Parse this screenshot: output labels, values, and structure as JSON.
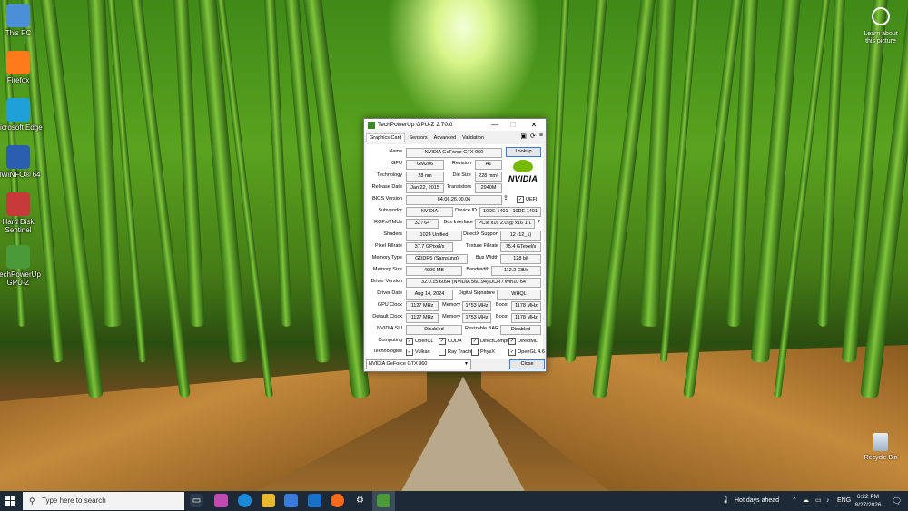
{
  "desktop": {
    "icons": [
      {
        "label": "This PC",
        "color": "#4a8fd8"
      },
      {
        "label": "Firefox",
        "color": "#ff7a1a"
      },
      {
        "label": "Microsoft Edge",
        "color": "#1fa0d8"
      },
      {
        "label": "HWiNFO® 64",
        "color": "#2a5fb0"
      },
      {
        "label": "Hard Disk Sentinel",
        "color": "#c83a3a"
      },
      {
        "label": "TechPowerUp GPU-Z",
        "color": "#4a9a3a"
      }
    ],
    "learn_label": "Learn about this picture",
    "recycle_label": "Recycle Bin"
  },
  "window": {
    "title": "TechPowerUp GPU-Z 2.70.0",
    "minimize": "—",
    "maximize": "☐",
    "close": "✕",
    "tabs": [
      "Graphics Card",
      "Sensors",
      "Advanced",
      "Validation"
    ],
    "lookup": "Lookup",
    "nvidia_logo_text": "NVIDIA",
    "fields": {
      "name_label": "Name",
      "name": "NVIDIA GeForce GTX 960",
      "gpu_label": "GPU",
      "gpu": "GM206",
      "revision_label": "Revision",
      "revision": "A1",
      "technology_label": "Technology",
      "technology": "28 nm",
      "die_size_label": "Die Size",
      "die_size": "228 mm²",
      "release_date_label": "Release Date",
      "release_date": "Jan 22, 2015",
      "transistors_label": "Transistors",
      "transistors": "2940M",
      "bios_label": "BIOS Version",
      "bios": "84.06.26.00.06",
      "uefi_label": "UEFI",
      "subvendor_label": "Subvendor",
      "subvendor": "NVIDIA",
      "device_id_label": "Device ID",
      "device_id": "10DE 1401 - 10DE 1401",
      "rops_label": "ROPs/TMUs",
      "rops": "32 / 64",
      "bus_interface_label": "Bus Interface",
      "bus_interface": "PCIe x16 2.0 @ x16 1.1",
      "help": "?",
      "shaders_label": "Shaders",
      "shaders": "1024 Unified",
      "directx_label": "DirectX Support",
      "directx": "12 (12_1)",
      "pixel_fillrate_label": "Pixel Fillrate",
      "pixel_fillrate": "37.7 GPixel/s",
      "texture_fillrate_label": "Texture Fillrate",
      "texture_fillrate": "75.4 GTexel/s",
      "memory_type_label": "Memory Type",
      "memory_type": "GDDR5 (Samsung)",
      "bus_width_label": "Bus Width",
      "bus_width": "128 bit",
      "memory_size_label": "Memory Size",
      "memory_size": "4096 MB",
      "bandwidth_label": "Bandwidth",
      "bandwidth": "112.2 GB/s",
      "driver_version_label": "Driver Version",
      "driver_version": "32.0.15.6094 (NVIDIA 560.94) DCH / Win10 64",
      "driver_date_label": "Driver Date",
      "driver_date": "Aug 14, 2024",
      "digital_signature_label": "Digital Signature",
      "digital_signature": "WHQL",
      "gpu_clock_label": "GPU Clock",
      "gpu_clock": "1127 MHz",
      "memory_clock_label": "Memory",
      "memory_clock": "1753 MHz",
      "boost_label": "Boost",
      "boost": "1178 MHz",
      "default_clock_label": "Default Clock",
      "default_clock": "1127 MHz",
      "default_memory": "1753 MHz",
      "default_boost": "1178 MHz",
      "sli_label": "NVIDIA SLI",
      "sli": "Disabled",
      "resizable_bar_label": "Resizable BAR",
      "resizable_bar": "Disabled"
    },
    "computing_label": "Computing",
    "computing": [
      {
        "label": "OpenCL",
        "checked": true
      },
      {
        "label": "CUDA",
        "checked": true
      },
      {
        "label": "DirectCompute",
        "checked": true
      },
      {
        "label": "DirectML",
        "checked": true
      }
    ],
    "technologies_label": "Technologies",
    "technologies": [
      {
        "label": "Vulkan",
        "checked": true
      },
      {
        "label": "Ray Tracing",
        "checked": false
      },
      {
        "label": "PhysX",
        "checked": false
      },
      {
        "label": "OpenGL 4.6",
        "checked": true
      }
    ],
    "gpu_select": "NVIDIA GeForce GTX 960",
    "close_button": "Close"
  },
  "taskbar": {
    "search_placeholder": "Type here to search",
    "weather": "Hot days ahead",
    "language": "ENG",
    "time": "6:22 PM",
    "date": "8/27/2026"
  }
}
